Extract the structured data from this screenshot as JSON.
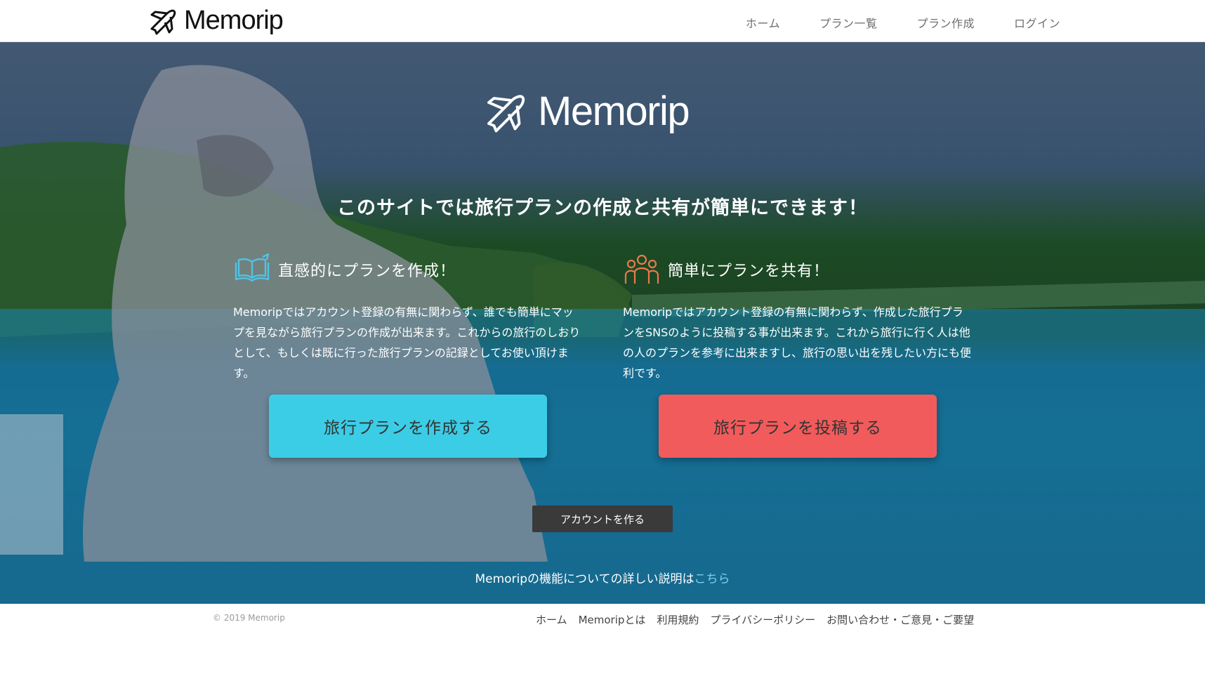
{
  "header": {
    "brand": "Memorip",
    "nav": [
      "ホーム",
      "プラン一覧",
      "プラン作成",
      "ログイン"
    ]
  },
  "hero": {
    "logo_text": "Memorip",
    "tagline": "このサイトでは旅行プランの作成と共有が簡単にできます！",
    "features": [
      {
        "icon": "open-book-icon",
        "title": "直感的にプランを作成！",
        "description": "Memoripではアカウント登録の有無に関わらず、誰でも簡単にマップを見ながら旅行プランの作成が出来ます。これからの旅行のしおりとして、もしくは既に行った旅行プランの記録としてお使い頂けます。",
        "button": "旅行プランを作成する",
        "button_color": "#3ccde6"
      },
      {
        "icon": "people-group-icon",
        "title": "簡単にプランを共有！",
        "description": "Memoripではアカウント登録の有無に関わらず、作成した旅行プランをSNSのように投稿する事が出来ます。これから旅行に行く人は他の人のプランを参考に出来ますし、旅行の思い出を残したい方にも便利です。",
        "button": "旅行プランを投稿する",
        "button_color": "#f25b5b"
      }
    ],
    "account_button": "アカウントを作る",
    "detail_text": "Memoripの機能についての詳しい説明は",
    "detail_link": "こちら"
  },
  "footer": {
    "copyright": "© 2019 Memorip",
    "links": [
      "ホーム",
      "Memoripとは",
      "利用規約",
      "プライバシーポリシー",
      "お問い合わせ・ご意見・ご要望"
    ]
  }
}
